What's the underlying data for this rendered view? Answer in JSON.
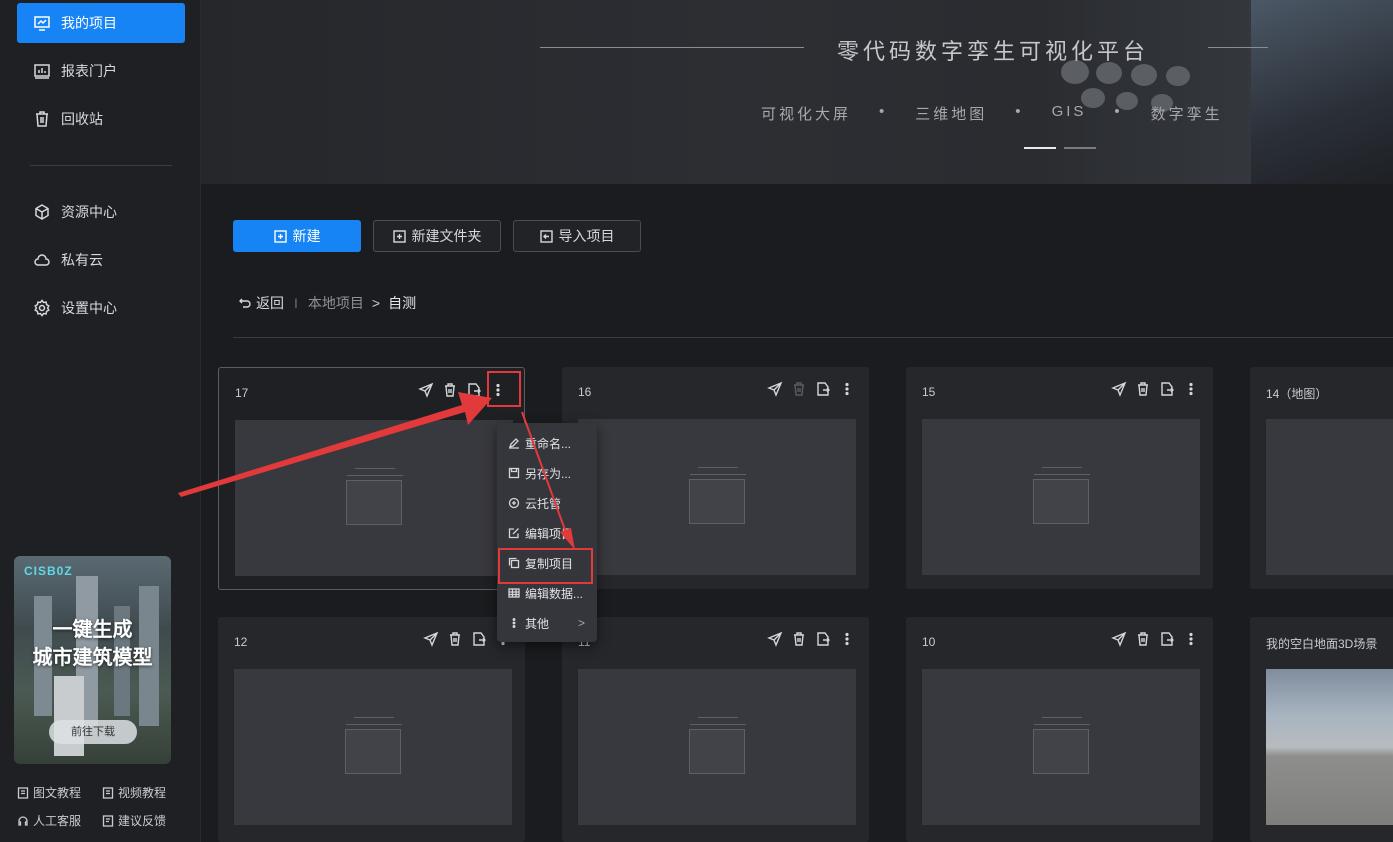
{
  "sidebar": {
    "nav": [
      {
        "label": "我的项目",
        "icon": "monitor-chart-icon",
        "active": true
      },
      {
        "label": "报表门户",
        "icon": "report-icon"
      },
      {
        "label": "回收站",
        "icon": "trash-icon"
      },
      {
        "label": "资源中心",
        "icon": "cube-icon"
      },
      {
        "label": "私有云",
        "icon": "cloud-icon"
      },
      {
        "label": "设置中心",
        "icon": "gear-icon"
      }
    ],
    "promo": {
      "logo": "CISB0Z",
      "title_line1": "一键生成",
      "title_line2": "城市建筑模型",
      "button": "前往下载"
    },
    "help": [
      {
        "label": "图文教程",
        "icon": "doc-icon"
      },
      {
        "label": "视频教程",
        "icon": "video-doc-icon"
      },
      {
        "label": "人工客服",
        "icon": "headset-icon"
      },
      {
        "label": "建议反馈",
        "icon": "feedback-icon"
      }
    ]
  },
  "banner": {
    "subtitle": "零代码数字孪生可视化平台",
    "tags": [
      "可视化大屏",
      "•",
      "三维地图",
      "•",
      "GIS",
      "•",
      "数字孪生"
    ]
  },
  "toolbar": {
    "new_label": "新建",
    "new_folder_label": "新建文件夹",
    "import_label": "导入项目"
  },
  "breadcrumb": {
    "back": "返回",
    "separator": "I",
    "path": "本地项目",
    "arrow": ">",
    "current": "自测"
  },
  "cards": [
    {
      "title": "17"
    },
    {
      "title": "16"
    },
    {
      "title": "15"
    },
    {
      "title": "14（地图）"
    },
    {
      "title": "12"
    },
    {
      "title": "11"
    },
    {
      "title": "10"
    },
    {
      "title": "我的空白地面3D场景"
    }
  ],
  "context_menu": [
    {
      "label": "重命名...",
      "icon": "pencil-icon"
    },
    {
      "label": "另存为...",
      "icon": "save-icon"
    },
    {
      "label": "云托管",
      "icon": "cloud-plus-icon"
    },
    {
      "label": "编辑项目",
      "icon": "edit-icon"
    },
    {
      "label": "复制项目",
      "icon": "copy-icon"
    },
    {
      "label": "编辑数据...",
      "icon": "table-icon"
    },
    {
      "label": "其他",
      "icon": "more-vertical-icon"
    }
  ],
  "colors": {
    "accent": "#1784f5",
    "highlight": "#e23a3a"
  }
}
